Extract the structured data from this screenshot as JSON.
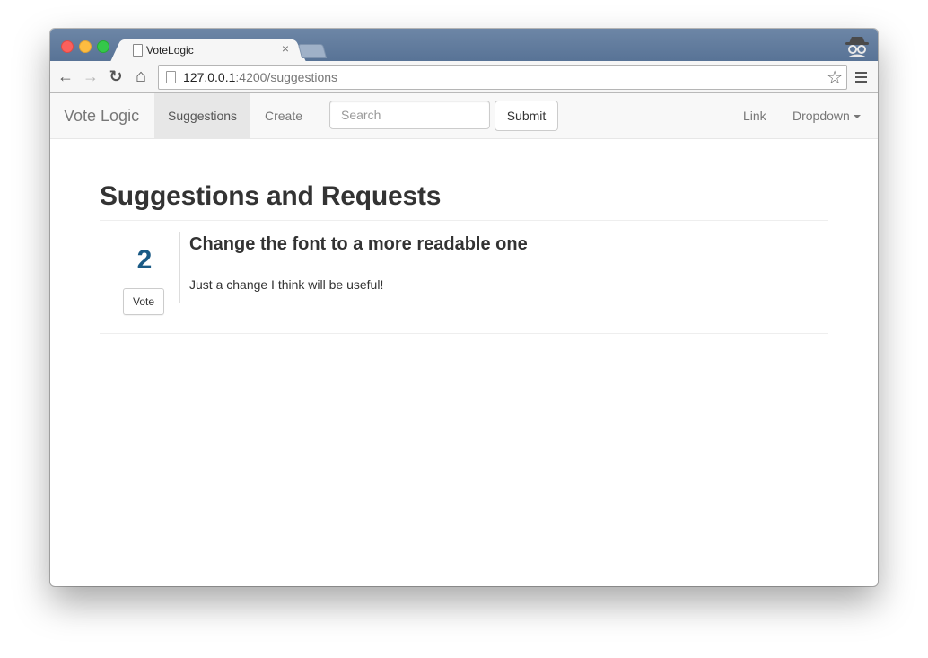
{
  "browser": {
    "tab_title": "VoteLogic",
    "tab_close": "×",
    "url_host": "127.0.0.1",
    "url_rest": ":4200/suggestions",
    "star_glyph": "☆",
    "back_glyph": "←",
    "forward_glyph": "→",
    "reload_glyph": "↻",
    "home_glyph": "⌂"
  },
  "navbar": {
    "brand": "Vote Logic",
    "links": [
      {
        "label": "Suggestions",
        "active": true
      },
      {
        "label": "Create",
        "active": false
      }
    ],
    "search_placeholder": "Search",
    "submit_label": "Submit",
    "right_link": "Link",
    "dropdown_label": "Dropdown"
  },
  "main": {
    "page_title": "Suggestions and Requests",
    "suggestions": [
      {
        "votes": "2",
        "vote_label": "Vote",
        "title": "Change the font to a more readable one",
        "description": "Just a change I think will be useful!"
      }
    ]
  },
  "colors": {
    "vote_count": "#1a5a85",
    "navbar_bg": "#f8f8f8",
    "titlebar": "#587396"
  }
}
